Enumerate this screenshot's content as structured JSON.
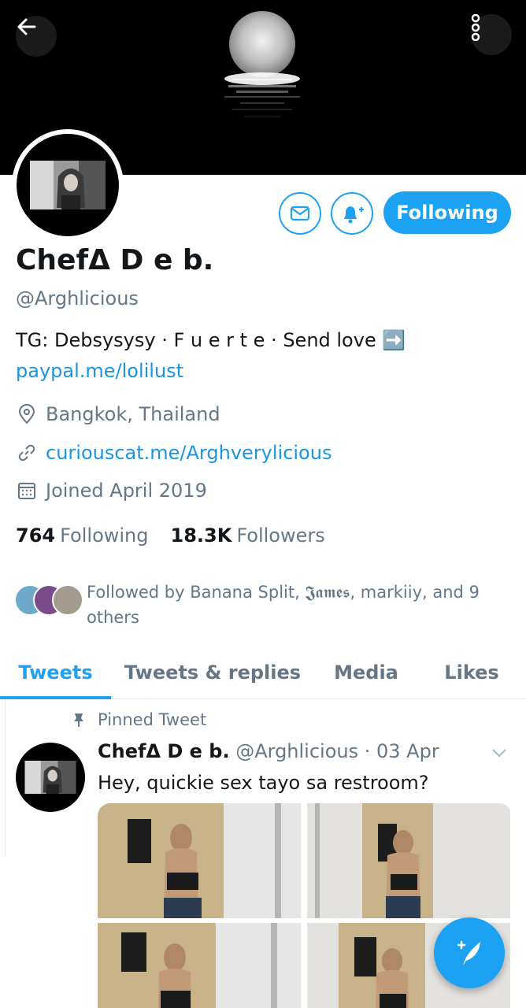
{
  "header": {
    "back_icon": "arrow-left-icon",
    "more_icon": "more-vertical-icon",
    "banner_desc": "moon-over-water"
  },
  "profile": {
    "display_name": "ChefΔ D e b.",
    "handle": "@Arghlicious",
    "bio_line": "TG: Debsysysy · F u e r t e · Send love ➡️",
    "bio_link": "paypal.me/lolilust",
    "location": "Bangkok, Thailand",
    "website": "curiouscat.me/Arghverylicious",
    "joined": "Joined April 2019",
    "following_count": "764",
    "following_label": "Following",
    "followers_count": "18.3K",
    "followers_label": "Followers",
    "followed_by": "Followed by Banana Split, 𝕵𝖆𝖒𝖊𝖘, markiiy, and 9 others"
  },
  "actions": {
    "following_label": "Following",
    "dm_icon": "mail-icon",
    "notify_icon": "bell-plus-icon"
  },
  "tabs": [
    {
      "label": "Tweets",
      "active": true
    },
    {
      "label": "Tweets & replies",
      "active": false
    },
    {
      "label": "Media",
      "active": false
    },
    {
      "label": "Likes",
      "active": false
    }
  ],
  "pinned_tweet": {
    "pinned_label": "Pinned Tweet",
    "name": "ChefΔ D e b.",
    "handle": "@Arghlicious",
    "date": "· 03 Apr",
    "text": "Hey, quickie sex tayo sa restroom?"
  },
  "fab": {
    "icon": "compose-tweet-icon"
  },
  "colors": {
    "accent": "#1da1f2",
    "link": "#1b95e0",
    "secondary_text": "#657786",
    "primary_text": "#14171a"
  }
}
